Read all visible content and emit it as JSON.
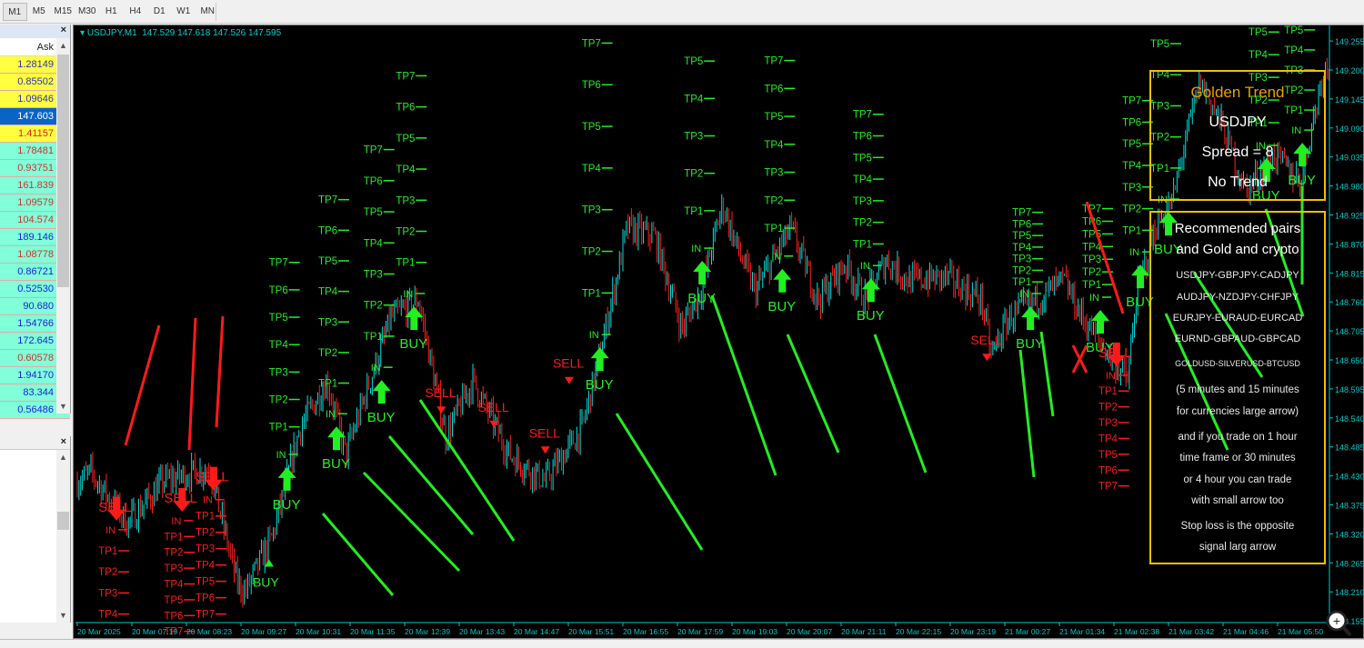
{
  "toolbar": {
    "timeframes": [
      "M1",
      "M5",
      "M15",
      "M30",
      "H1",
      "H4",
      "D1",
      "W1",
      "MN"
    ],
    "active": "M1"
  },
  "market_watch": {
    "column": "Ask",
    "close": "×",
    "rows": [
      {
        "ask": "1.28149",
        "bg": "#ffff40",
        "fg": "#3030c0"
      },
      {
        "ask": "0.85502",
        "bg": "#ffff40",
        "fg": "#3030c0"
      },
      {
        "ask": "1.09646",
        "bg": "#ffff40",
        "fg": "#3030c0"
      },
      {
        "ask": "147.603",
        "bg": "#0a64c8",
        "fg": "#ffffff"
      },
      {
        "ask": "1.41157",
        "bg": "#ffff40",
        "fg": "#e02020"
      },
      {
        "ask": "1.78481",
        "bg": "#80ffd8",
        "fg": "#d03030"
      },
      {
        "ask": "0.93751",
        "bg": "#80ffd8",
        "fg": "#d03030"
      },
      {
        "ask": "161.839",
        "bg": "#80ffd8",
        "fg": "#d03030"
      },
      {
        "ask": "1.09579",
        "bg": "#80ffd8",
        "fg": "#d03030"
      },
      {
        "ask": "104.574",
        "bg": "#80ffd8",
        "fg": "#d03030"
      },
      {
        "ask": "189.146",
        "bg": "#80ffd8",
        "fg": "#2020e0"
      },
      {
        "ask": "1.08778",
        "bg": "#80ffd8",
        "fg": "#d03030"
      },
      {
        "ask": "0.86721",
        "bg": "#80ffd8",
        "fg": "#2020e0"
      },
      {
        "ask": "0.52530",
        "bg": "#80ffd8",
        "fg": "#2020e0"
      },
      {
        "ask": "90.680",
        "bg": "#80ffd8",
        "fg": "#2020e0"
      },
      {
        "ask": "1.54766",
        "bg": "#80ffd8",
        "fg": "#2020e0"
      },
      {
        "ask": "172.645",
        "bg": "#80ffd8",
        "fg": "#2020e0"
      },
      {
        "ask": "0.60578",
        "bg": "#80ffd8",
        "fg": "#d03030"
      },
      {
        "ask": "1.94170",
        "bg": "#80ffd8",
        "fg": "#2020e0"
      },
      {
        "ask": "83.344",
        "bg": "#80ffd8",
        "fg": "#2020e0"
      },
      {
        "ask": "0.56486",
        "bg": "#80ffd8",
        "fg": "#2020e0"
      }
    ]
  },
  "navigator": {
    "close": "×"
  },
  "chart_header": {
    "symbol": "USDJPY,M1",
    "ohlc": "147.529 147.618 147.526 147.595"
  },
  "colors": {
    "bull": "#00e0e0",
    "bear": "#ff2020",
    "buy": "#22ee22",
    "sell": "#ff1a1a",
    "axis": "#00c8c8",
    "box": "#f0c000",
    "title": "#e8a000"
  },
  "chart_data": {
    "type": "candlestick",
    "symbol": "USDJPY",
    "timeframe": "M1",
    "ylim": [
      148.14,
      149.28
    ],
    "price_ticks": [
      "149.255",
      "149.200",
      "149.145",
      "149.090",
      "149.035",
      "148.980",
      "148.925",
      "148.870",
      "148.815",
      "148.760",
      "148.705",
      "148.650",
      "148.595",
      "148.540",
      "148.485",
      "148.430",
      "148.375",
      "148.320",
      "148.265",
      "148.210",
      "148.155"
    ],
    "time_ticks": [
      "20 Mar 2025",
      "20 Mar 07:19",
      "20 Mar 08:23",
      "20 Mar 09:27",
      "20 Mar 10:31",
      "20 Mar 11:35",
      "20 Mar 12:39",
      "20 Mar 13:43",
      "20 Mar 14:47",
      "20 Mar 15:51",
      "20 Mar 16:55",
      "20 Mar 17:59",
      "20 Mar 19:03",
      "20 Mar 20:07",
      "20 Mar 21:11",
      "20 Mar 22:15",
      "20 Mar 23:19",
      "21 Mar 00:27",
      "21 Mar 01:34",
      "21 Mar 02:38",
      "21 Mar 03:42",
      "21 Mar 04:46",
      "21 Mar 05:50"
    ],
    "time_tick_step_minutes": 64,
    "price_path": [
      [
        0,
        148.42
      ],
      [
        16,
        148.436
      ],
      [
        59,
        148.34
      ],
      [
        101,
        148.42
      ],
      [
        155,
        148.445
      ],
      [
        187,
        148.23
      ],
      [
        197,
        148.21
      ],
      [
        229,
        148.316
      ],
      [
        261,
        148.52
      ],
      [
        293,
        148.61
      ],
      [
        315,
        148.47
      ],
      [
        336,
        148.574
      ],
      [
        368,
        148.73
      ],
      [
        400,
        148.764
      ],
      [
        432,
        148.505
      ],
      [
        464,
        148.61
      ],
      [
        507,
        148.47
      ],
      [
        549,
        148.42
      ],
      [
        592,
        148.52
      ],
      [
        613,
        148.66
      ],
      [
        645,
        148.9
      ],
      [
        677,
        148.885
      ],
      [
        709,
        148.71
      ],
      [
        731,
        148.78
      ],
      [
        757,
        148.945
      ],
      [
        773,
        148.867
      ],
      [
        795,
        148.78
      ],
      [
        837,
        148.9
      ],
      [
        869,
        148.764
      ],
      [
        901,
        148.833
      ],
      [
        923,
        148.764
      ],
      [
        949,
        148.84
      ],
      [
        976,
        148.8
      ],
      [
        1019,
        148.807
      ],
      [
        1061,
        148.764
      ],
      [
        1072,
        148.66
      ],
      [
        1093,
        148.73
      ],
      [
        1125,
        148.764
      ],
      [
        1157,
        148.8
      ],
      [
        1179,
        148.73
      ],
      [
        1211,
        148.66
      ],
      [
        1232,
        148.61
      ],
      [
        1243,
        148.78
      ],
      [
        1264,
        148.9
      ],
      [
        1285,
        148.953
      ],
      [
        1296,
        149.04
      ],
      [
        1317,
        149.178
      ],
      [
        1339,
        149.109
      ],
      [
        1371,
        148.97
      ],
      [
        1403,
        149.04
      ],
      [
        1435,
        148.988
      ],
      [
        1461,
        149.195
      ],
      [
        1469,
        149.21
      ]
    ]
  },
  "labels": {
    "buy": "BUY",
    "sell": "SELL",
    "in": "IN",
    "tp": [
      "TP1",
      "TP2",
      "TP3",
      "TP4",
      "TP5",
      "TP6",
      "TP7"
    ],
    "x": "X"
  },
  "signals": [
    {
      "side": "sell",
      "t": 46,
      "entry": 148.328,
      "step": 0.04,
      "n": 4
    },
    {
      "side": "sell",
      "t": 123,
      "entry": 148.345,
      "step": 0.03,
      "n": 7
    },
    {
      "side": "sell",
      "t": 160,
      "entry": 148.385,
      "step": 0.031,
      "n": 7
    },
    {
      "side": "buy",
      "t": 246,
      "entry": 148.471,
      "step": 0.052,
      "n": 7
    },
    {
      "side": "buy",
      "t": 304,
      "entry": 148.548,
      "step": 0.058,
      "n": 7
    },
    {
      "side": "buy",
      "t": 357,
      "entry": 148.636,
      "step": 0.059,
      "n": 7
    },
    {
      "side": "buy",
      "t": 395,
      "entry": 148.776,
      "step": 0.059,
      "n": 7
    },
    {
      "side": "buy",
      "t": 613,
      "entry": 148.698,
      "step": 0.079,
      "n": 7
    },
    {
      "side": "buy",
      "t": 733,
      "entry": 148.862,
      "step": 0.071,
      "n": 5
    },
    {
      "side": "buy",
      "t": 827,
      "entry": 148.847,
      "step": 0.053,
      "n": 7
    },
    {
      "side": "buy",
      "t": 931,
      "entry": 148.829,
      "step": 0.041,
      "n": 7
    },
    {
      "side": "buy",
      "t": 1118,
      "entry": 148.776,
      "step": 0.022,
      "n": 7
    },
    {
      "side": "buy",
      "t": 1200,
      "entry": 148.769,
      "step": 0.024,
      "n": 7
    },
    {
      "side": "sell",
      "t": 1219,
      "entry": 148.621,
      "step": 0.03,
      "n": 7
    },
    {
      "side": "buy",
      "t": 1247,
      "entry": 148.855,
      "step": 0.041,
      "n": 7
    },
    {
      "side": "buy",
      "t": 1280,
      "entry": 148.955,
      "step": 0.059,
      "n": 5
    },
    {
      "side": "buy",
      "t": 1395,
      "entry": 149.057,
      "step": 0.043,
      "n": 5
    },
    {
      "side": "buy",
      "t": 1437,
      "entry": 149.086,
      "step": 0.038,
      "n": 5
    }
  ],
  "small_signals": [
    {
      "side": "sell",
      "t": 427,
      "p": 148.579
    },
    {
      "side": "sell",
      "t": 489,
      "p": 148.552
    },
    {
      "side": "sell",
      "t": 549,
      "p": 148.503
    },
    {
      "side": "sell",
      "t": 577,
      "p": 148.635
    },
    {
      "side": "sell",
      "t": 1067,
      "p": 148.679
    },
    {
      "side": "buy",
      "t": 225,
      "p": 148.22
    }
  ],
  "panel_trend": {
    "title": "Golden Trend",
    "symbol": "USDJPY",
    "spread": "Spread = 8",
    "trend": "No Trend"
  },
  "panel_info": {
    "heading": [
      "Recommended pairs",
      "and Gold and crypto"
    ],
    "pairs": [
      "USDJPY-GBPJPY-CADJPY",
      "AUDJPY-NZDJPY-CHFJPY",
      "EURJPY-EURAUD-EURCAD",
      "EURND-GBPAUD-GBPCAD",
      "GOLDUSD-SILVERUSD-BTCUSD"
    ],
    "notes": [
      "(5 minutes and 15 minutes",
      "for currencies large arrow)",
      "and if you trade on 1 hour",
      "time frame or 30 minutes",
      "or 4 hour you can trade",
      "with small arrow too",
      "Stop loss is the opposite",
      "signal larg arrow"
    ]
  }
}
